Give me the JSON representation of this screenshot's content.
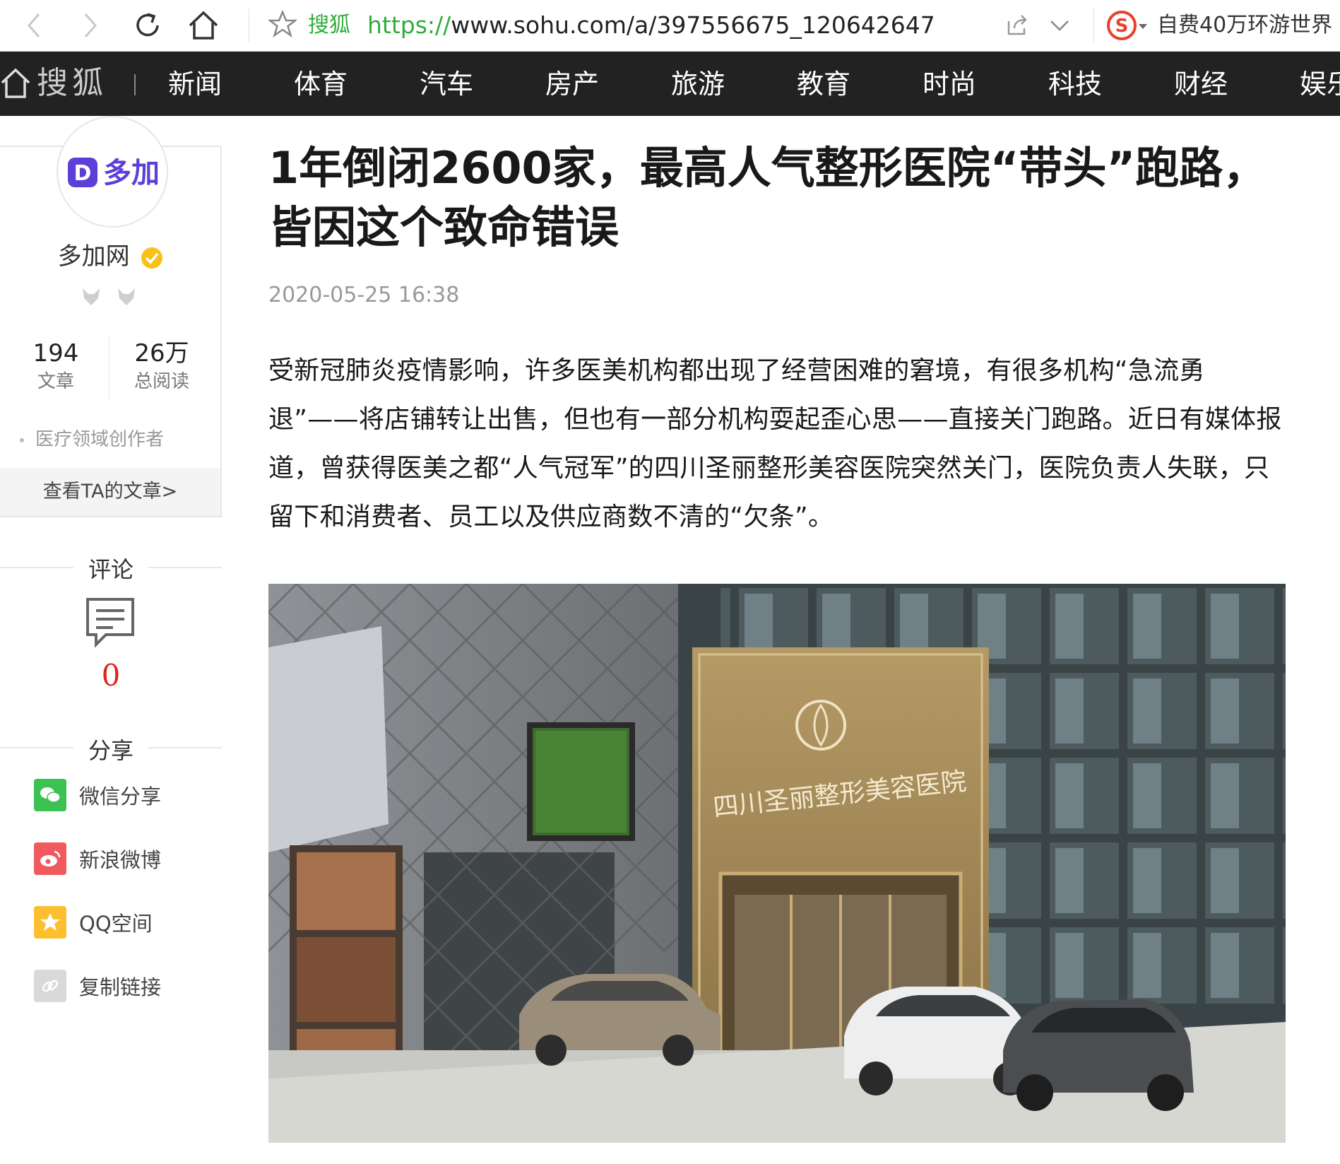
{
  "browser": {
    "site_name": "搜狐",
    "url_protocol": "https://",
    "url_rest": "www.sohu.com/a/397556675_120642647",
    "search_suggestion": "自费40万环游世界"
  },
  "nav": {
    "logo": "搜狐",
    "items": [
      "新闻",
      "体育",
      "汽车",
      "房产",
      "旅游",
      "教育",
      "时尚",
      "科技",
      "财经",
      "娱乐"
    ]
  },
  "author": {
    "logo_text": "多加",
    "name": "多加网",
    "articles_count": "194",
    "articles_label": "文章",
    "reads_count": "26万",
    "reads_label": "总阅读",
    "field": "医疗领域创作者",
    "view_articles": "查看TA的文章>"
  },
  "comments": {
    "title": "评论",
    "count": "0"
  },
  "share": {
    "title": "分享",
    "items": [
      {
        "label": "微信分享",
        "icon": "wechat-icon",
        "color": "#3cc251"
      },
      {
        "label": "新浪微博",
        "icon": "weibo-icon",
        "color": "#f05a5f"
      },
      {
        "label": "QQ空间",
        "icon": "qzone-icon",
        "color": "#fdbf2d"
      },
      {
        "label": "复制链接",
        "icon": "link-icon",
        "color": "#d9d9d9"
      }
    ]
  },
  "article": {
    "title": "1年倒闭2600家，最高人气整形医院“带头”跑路，皆因这个致命错误",
    "time": "2020-05-25 16:38",
    "lead": "受新冠肺炎疫情影响，许多医美机构都出现了经营困难的窘境，有很多机构“急流勇退”——将店铺转让出售，但也有一部分机构耍起歪心思——直接关门跑路。近日有媒体报道，曾获得医美之都“人气冠军”的四川圣丽整形美容医院突然关门，医院负责人失联，只留下和消费者、员工以及供应商数不清的“欠条”。",
    "image_sign_text": "四川圣丽整形美容医院"
  },
  "colors": {
    "nav_bg": "#222222",
    "accent_green": "#2fae3b",
    "comment_red": "#e2231a",
    "brand_purple": "#5b3fd6"
  }
}
